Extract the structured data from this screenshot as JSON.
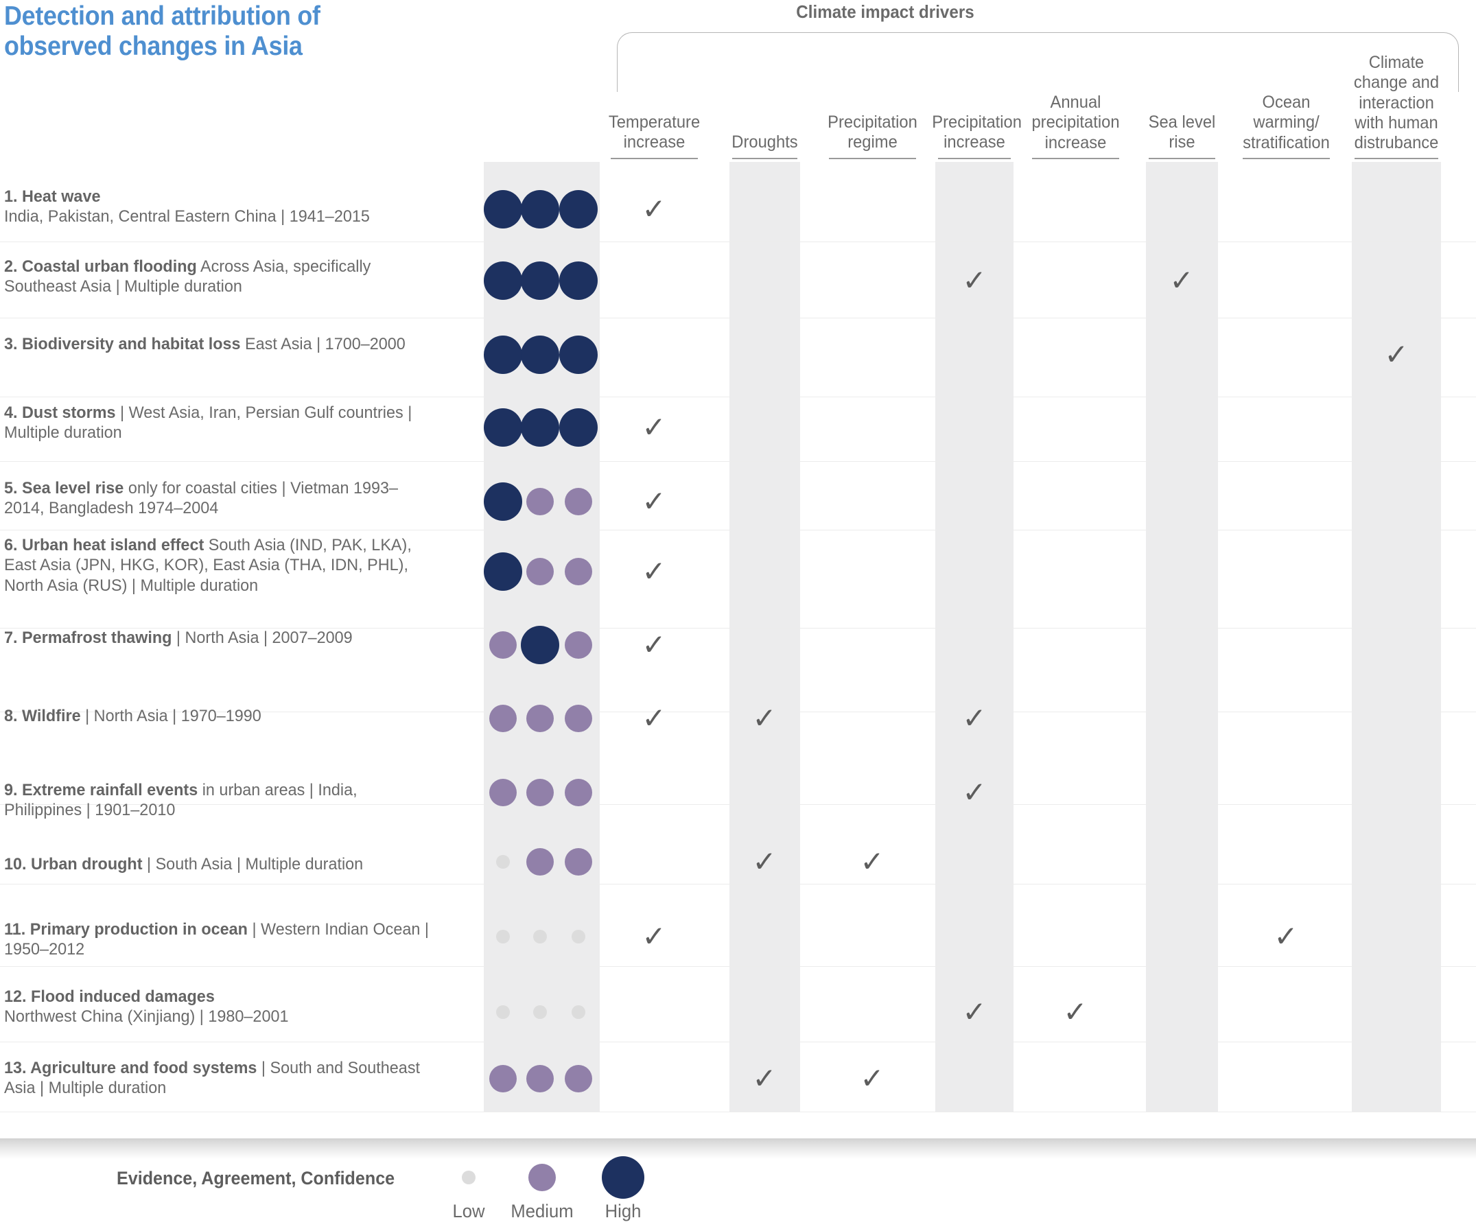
{
  "title": "Detection and attribution\nof observed changes in Asia",
  "group_header": "Climate impact drivers",
  "eac_headers": [
    "Evidence",
    "Agreement",
    "Confidence"
  ],
  "driver_columns": [
    {
      "label": "Temperature\nincrease",
      "shaded": false
    },
    {
      "label": "Droughts",
      "shaded": true
    },
    {
      "label": "Precipitation\nregime",
      "shaded": false
    },
    {
      "label": "Precipitation\nincrease",
      "shaded": true
    },
    {
      "label": "Annual\nprecipitation\nincrease",
      "shaded": false
    },
    {
      "label": "Sea level\nrise",
      "shaded": true
    },
    {
      "label": "Ocean\nwarming/\nstratification",
      "shaded": false
    },
    {
      "label": "Climate\nchange and\ninteraction\nwith human\ndistrubance",
      "shaded": true
    }
  ],
  "rows": [
    {
      "num": "1.",
      "name": "Heat wave",
      "detail": "India, Pakistan, Central Eastern China | 1941–2015",
      "inline": false,
      "evidence": "high",
      "agreement": "high",
      "confidence": "high",
      "drivers": [
        true,
        false,
        false,
        false,
        false,
        false,
        false,
        false
      ]
    },
    {
      "num": "2.",
      "name": "Coastal urban flooding",
      "detail": "Across Asia, specifically Southeast Asia | Multiple duration",
      "inline": true,
      "evidence": "high",
      "agreement": "high",
      "confidence": "high",
      "drivers": [
        false,
        false,
        false,
        true,
        false,
        true,
        false,
        false
      ]
    },
    {
      "num": "3.",
      "name": "Biodiversity and habitat loss",
      "detail": "East Asia | 1700–2000",
      "inline": true,
      "evidence": "high",
      "agreement": "high",
      "confidence": "high",
      "drivers": [
        false,
        false,
        false,
        false,
        false,
        false,
        false,
        true
      ]
    },
    {
      "num": "4.",
      "name": "Dust storms",
      "detail": "| West Asia, Iran, Persian Gulf countries | Multiple duration",
      "inline": true,
      "evidence": "high",
      "agreement": "high",
      "confidence": "high",
      "drivers": [
        true,
        false,
        false,
        false,
        false,
        false,
        false,
        false
      ]
    },
    {
      "num": "5.",
      "name": "Sea level rise",
      "detail": "only for coastal cities | Vietman 1993–2014, Bangladesh 1974–2004",
      "inline": true,
      "evidence": "high",
      "agreement": "medium",
      "confidence": "medium",
      "drivers": [
        true,
        false,
        false,
        false,
        false,
        false,
        false,
        false
      ]
    },
    {
      "num": "6.",
      "name": "Urban heat island effect",
      "detail": "South Asia (IND, PAK, LKA), East Asia (JPN, HKG, KOR), East Asia (THA, IDN, PHL), North Asia (RUS) | Multiple duration",
      "inline": true,
      "evidence": "high",
      "agreement": "medium",
      "confidence": "medium",
      "drivers": [
        true,
        false,
        false,
        false,
        false,
        false,
        false,
        false
      ]
    },
    {
      "num": "7.",
      "name": "Permafrost thawing",
      "detail": "| North Asia | 2007–2009",
      "inline": true,
      "evidence": "medium",
      "agreement": "high",
      "confidence": "medium",
      "drivers": [
        true,
        false,
        false,
        false,
        false,
        false,
        false,
        false
      ]
    },
    {
      "num": "8.",
      "name": "Wildfire",
      "detail": "| North Asia | 1970–1990",
      "inline": true,
      "evidence": "medium",
      "agreement": "medium",
      "confidence": "medium",
      "drivers": [
        true,
        true,
        false,
        true,
        false,
        false,
        false,
        false
      ]
    },
    {
      "num": "9.",
      "name": "Extreme rainfall events",
      "detail": "in urban areas | India, Philippines | 1901–2010",
      "inline": true,
      "evidence": "medium",
      "agreement": "medium",
      "confidence": "medium",
      "drivers": [
        false,
        false,
        false,
        true,
        false,
        false,
        false,
        false
      ]
    },
    {
      "num": "10.",
      "name": "Urban drought",
      "detail": "| South Asia | Multiple duration",
      "inline": true,
      "evidence": "low",
      "agreement": "medium",
      "confidence": "medium",
      "drivers": [
        false,
        true,
        true,
        false,
        false,
        false,
        false,
        false
      ]
    },
    {
      "num": "11.",
      "name": "Primary production in ocean",
      "detail": "| Western Indian Ocean | 1950–2012",
      "inline": true,
      "evidence": "low",
      "agreement": "low",
      "confidence": "low",
      "drivers": [
        true,
        false,
        false,
        false,
        false,
        false,
        true,
        false
      ]
    },
    {
      "num": "12.",
      "name": "Flood induced damages",
      "detail": "Northwest China (Xinjiang) | 1980–2001",
      "inline": false,
      "evidence": "low",
      "agreement": "low",
      "confidence": "low",
      "drivers": [
        false,
        false,
        false,
        true,
        true,
        false,
        false,
        false
      ]
    },
    {
      "num": "13.",
      "name": "Agriculture and food systems",
      "detail": "| South and Southeast Asia | Multiple duration",
      "inline": true,
      "evidence": "medium",
      "agreement": "medium",
      "confidence": "medium",
      "drivers": [
        false,
        true,
        true,
        false,
        false,
        false,
        false,
        false
      ]
    }
  ],
  "legend": {
    "title": "Evidence, Agreement, Confidence",
    "items": [
      {
        "level": "low",
        "label": "Low"
      },
      {
        "level": "medium",
        "label": "Medium"
      },
      {
        "level": "high",
        "label": "High"
      }
    ]
  },
  "colors": {
    "title_blue": "#4e8fd0",
    "high": "#1d3160",
    "medium": "#9180a9",
    "low": "#dcdcdc",
    "shade": "#ececed",
    "text": "#6a6a6a",
    "check": "#5d5d5d"
  },
  "check_glyph": "✓"
}
